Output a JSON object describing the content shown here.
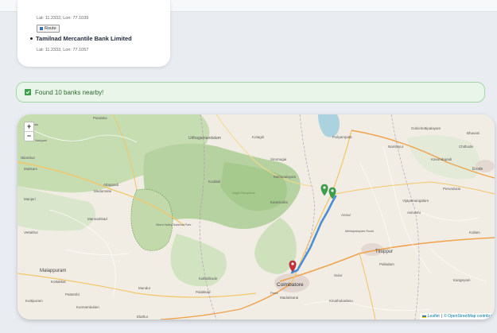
{
  "list": {
    "first_coords": "Lat: 11.2332, Lon: 77.1039",
    "route_label": "Route",
    "bank_name": "Tamilnad Mercantile Bank Limited",
    "bank_coords": "Lat: 11.2333, Lon: 77.1057"
  },
  "alert": {
    "text": "Found 10 banks nearby!",
    "color": "#3aa14a"
  },
  "map": {
    "zoom_in": "+",
    "zoom_out": "−",
    "attribution_leaflet": "Leaflet",
    "attribution_sep": "|",
    "attribution_osm": "© OpenStreetMap contribut",
    "route_color": "#4a8fd6",
    "destination_marker_color": "#3aa14a",
    "origin_marker_color": "#c9303a",
    "labels": {
      "l1": "Pandalur",
      "l2": "Erumadu",
      "l3": "Nadgani",
      "l4": "Udhagamandalam",
      "l5": "Kotagiri",
      "l6": "Sirumugai",
      "l7": "Mettupalayam",
      "l8": "Gobichettipalayam",
      "l9": "Bhavani",
      "l10": "Erode",
      "l11": "Perundurai",
      "l12": "Nambiyur",
      "l13": "Puliyampatti",
      "l14": "Kavundapadi",
      "l15": "Chithode",
      "l16": "Nilambur",
      "l17": "Mukkam",
      "l18": "Manjeri",
      "l19": "Mannarkkad",
      "l20": "Attappadi",
      "l21": "Kuddali",
      "l22": "Silent Valley National Park",
      "l23": "Mudumalai",
      "l24": "Annur",
      "l25": "Avinashi",
      "l26": "Tiruppur",
      "l27": "Palladam",
      "l28": "Coimbatore",
      "l29": "Malappuram",
      "l30": "Palakkad",
      "l31": "Kalladikode",
      "l32": "Mettupalayam Road",
      "l33": "Karamadai",
      "l34": "Kottakkal",
      "l35": "Pattambi",
      "l36": "Mundur",
      "l37": "Kunnamkulam",
      "l38": "Kinathukadavu",
      "l39": "Madukkarai",
      "l40": "Sulur",
      "l41": "Vijayamangalam",
      "l42": "Kangeyam",
      "l43": "Perur",
      "l44": "Nilgiri Biosphere",
      "l45": "Kollam",
      "l46": "Vettathur",
      "l47": "Kuttipuram",
      "l48": "Elathur"
    }
  }
}
